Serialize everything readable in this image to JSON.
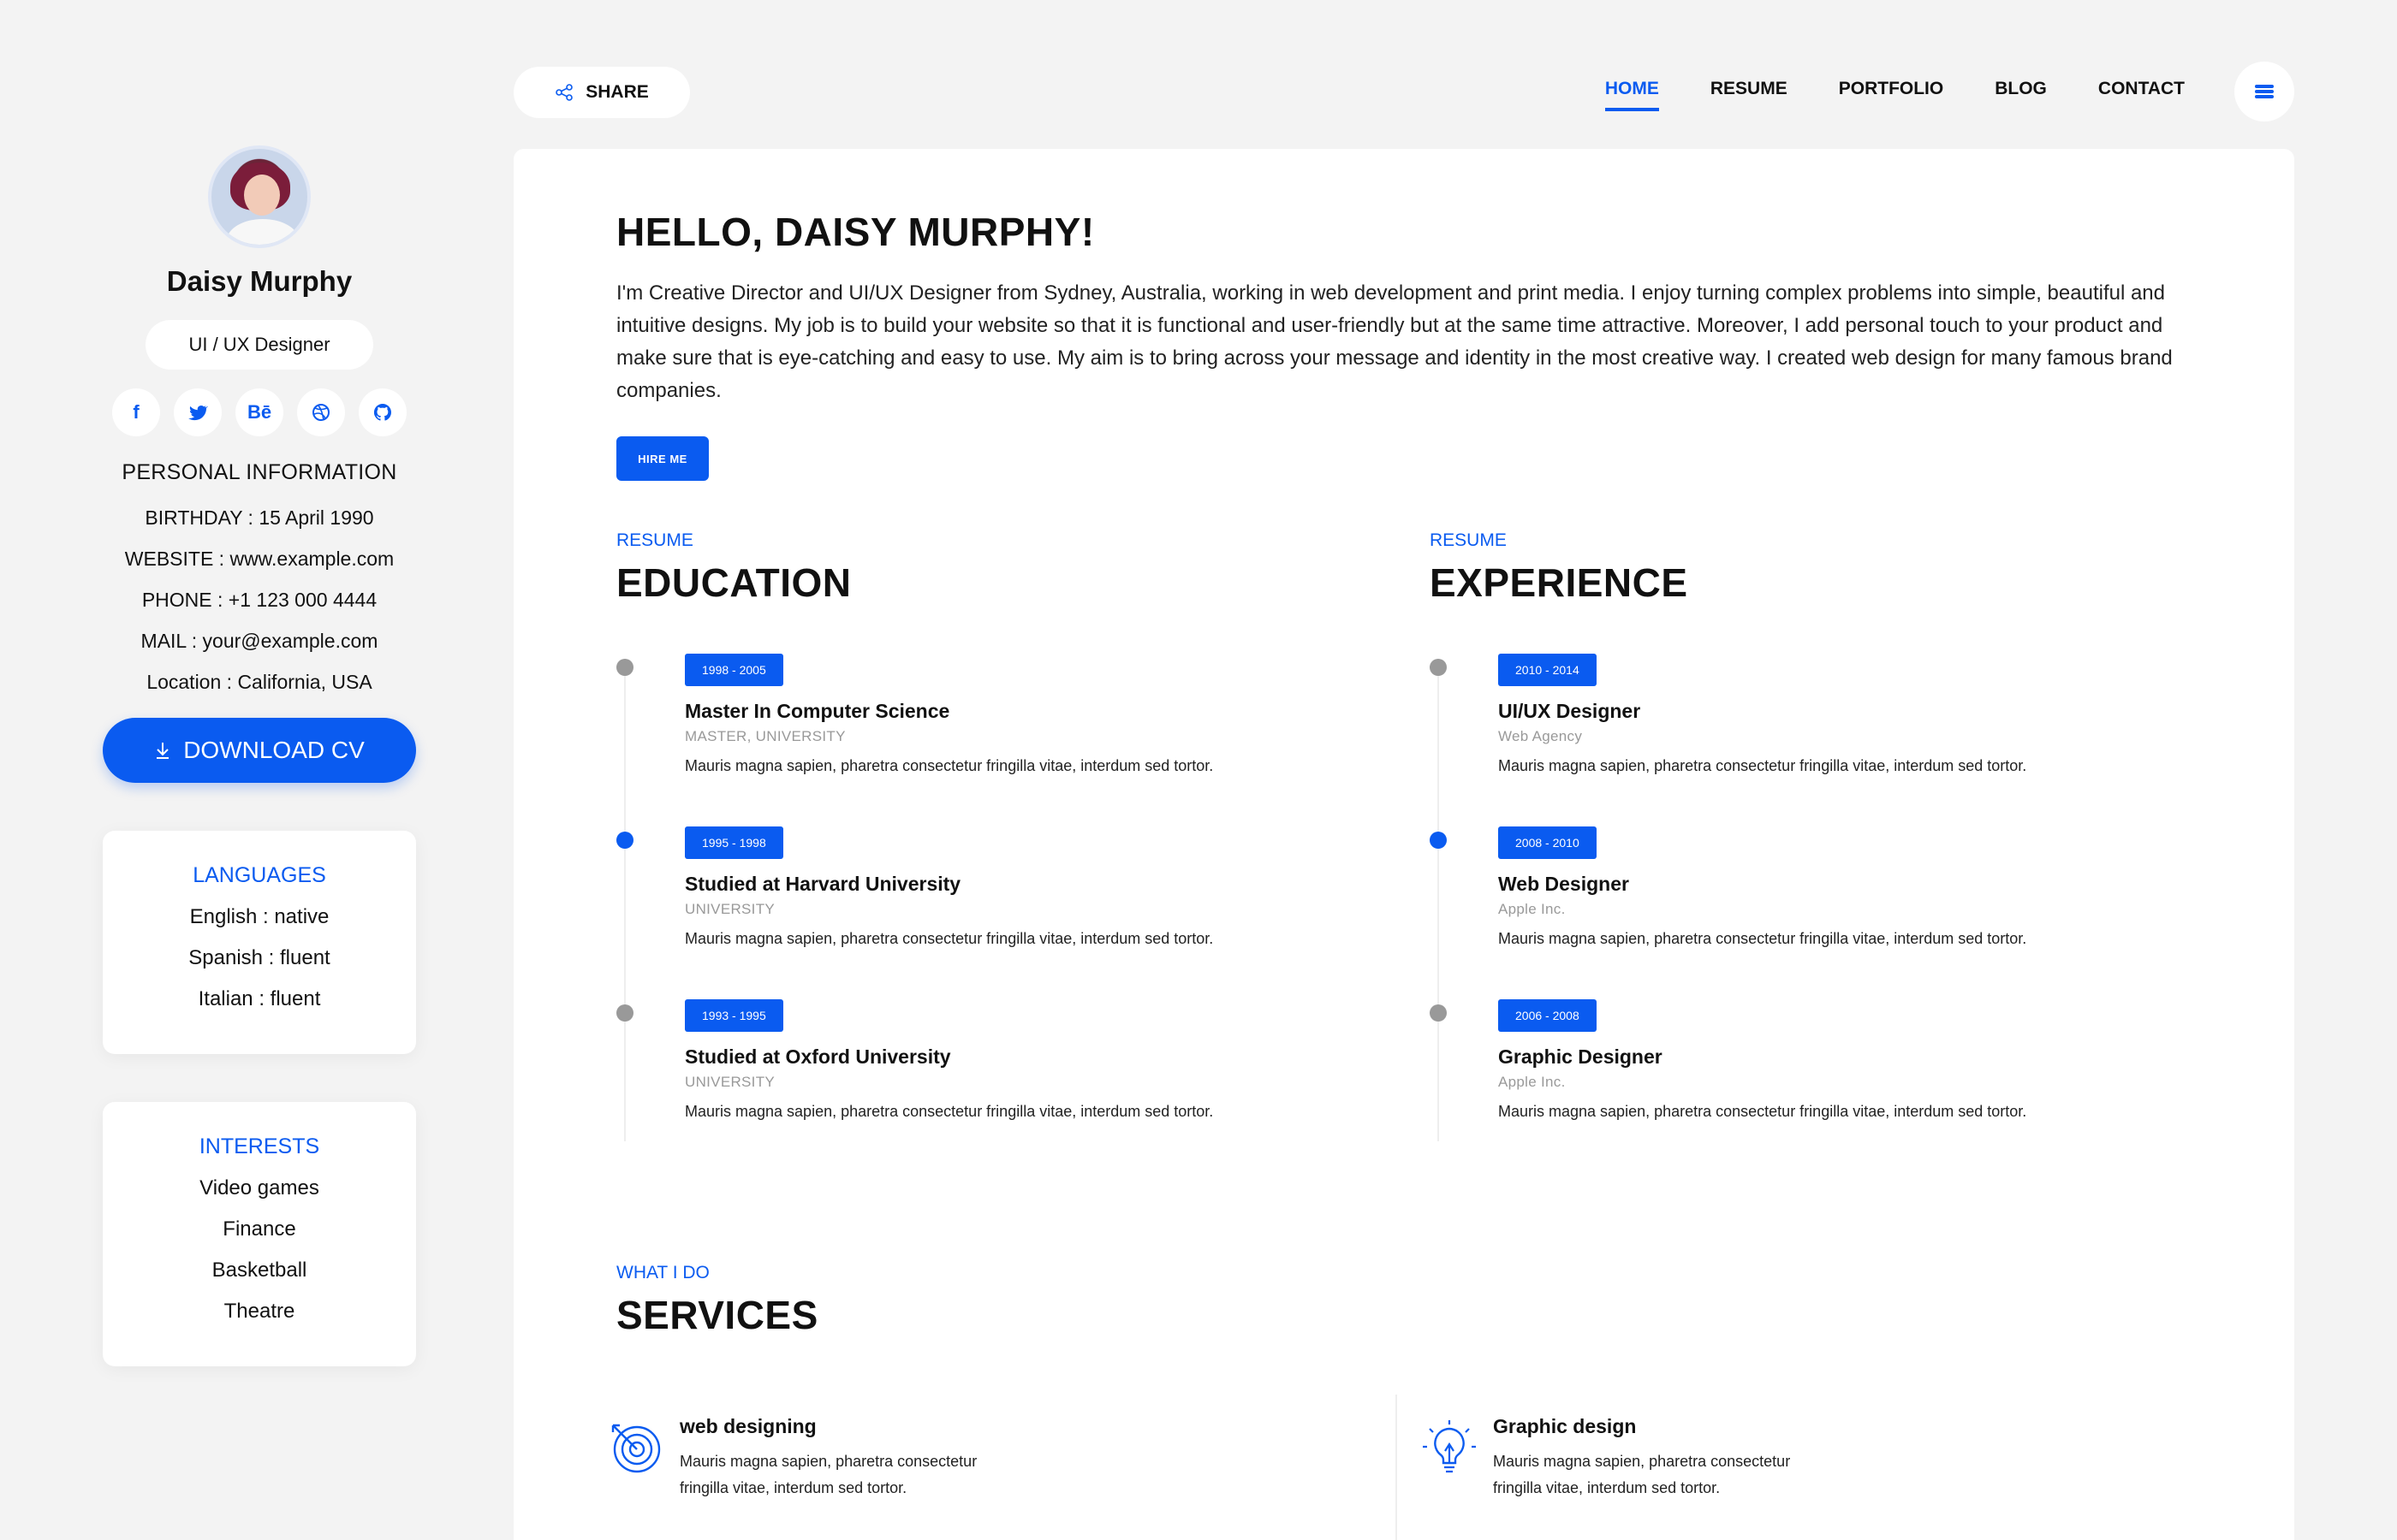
{
  "profile": {
    "name": "Daisy Murphy",
    "role": "UI / UX Designer",
    "socials": [
      {
        "icon": "facebook-icon",
        "glyph": "f"
      },
      {
        "icon": "twitter-icon",
        "glyph": "t"
      },
      {
        "icon": "behance-icon",
        "glyph": "Bē"
      },
      {
        "icon": "dribbble-icon",
        "glyph": "◎"
      },
      {
        "icon": "github-icon",
        "glyph": "⌾"
      }
    ],
    "personal_info_title": "PERSONAL INFORMATION",
    "personal_info": [
      "BIRTHDAY : 15 April 1990",
      "WEBSITE : www.example.com",
      "PHONE : +1 123 000 4444",
      "MAIL : your@example.com",
      "Location : California, USA"
    ],
    "download_label": "DOWNLOAD CV"
  },
  "languages": {
    "title": "LANGUAGES",
    "items": [
      "English : native",
      "Spanish : fluent",
      "Italian : fluent"
    ]
  },
  "interests": {
    "title": "INTERESTS",
    "items": [
      "Video games",
      "Finance",
      "Basketball",
      "Theatre"
    ]
  },
  "topbar": {
    "share_label": "SHARE",
    "nav": [
      "HOME",
      "RESUME",
      "PORTFOLIO",
      "BLOG",
      "CONTACT"
    ],
    "active_nav": "HOME"
  },
  "main": {
    "greeting": "HELLO, DAISY MURPHY!",
    "intro": "I'm Creative Director and UI/UX Designer from Sydney, Australia, working in web development and print media. I enjoy turning complex problems into simple, beautiful and intuitive designs. My job is to build your website so that it is functional and user-friendly but at the same time attractive. Moreover, I add personal touch to your product and make sure that is eye-catching and easy to use. My aim is to bring across your message and identity in the most creative way. I created web design for many famous brand companies.",
    "hire_label": "HIRE ME",
    "education": {
      "kicker": "RESUME",
      "title": "EDUCATION",
      "items": [
        {
          "date": "1998 - 2005",
          "title": "Master In Computer Science",
          "sub": "MASTER, UNIVERSITY",
          "desc": "Mauris magna sapien, pharetra consectetur fringilla vitae, interdum sed tortor.",
          "active": false
        },
        {
          "date": "1995 - 1998",
          "title": "Studied at Harvard University",
          "sub": "UNIVERSITY",
          "desc": "Mauris magna sapien, pharetra consectetur fringilla vitae, interdum sed tortor.",
          "active": true
        },
        {
          "date": "1993 - 1995",
          "title": "Studied at Oxford University",
          "sub": "UNIVERSITY",
          "desc": "Mauris magna sapien, pharetra consectetur fringilla vitae, interdum sed tortor.",
          "active": false
        }
      ]
    },
    "experience": {
      "kicker": "RESUME",
      "title": "EXPERIENCE",
      "items": [
        {
          "date": "2010 - 2014",
          "title": "UI/UX Designer",
          "sub": "Web Agency",
          "desc": "Mauris magna sapien, pharetra consectetur fringilla vitae, interdum sed tortor.",
          "active": false
        },
        {
          "date": "2008 - 2010",
          "title": "Web Designer",
          "sub": "Apple Inc.",
          "desc": "Mauris magna sapien, pharetra consectetur fringilla vitae, interdum sed tortor.",
          "active": true
        },
        {
          "date": "2006 - 2008",
          "title": "Graphic Designer",
          "sub": "Apple Inc.",
          "desc": "Mauris magna sapien, pharetra consectetur fringilla vitae, interdum sed tortor.",
          "active": false
        }
      ]
    },
    "services": {
      "kicker": "WHAT I DO",
      "title": "SERVICES",
      "items": [
        {
          "icon": "target-icon",
          "title": "web designing",
          "desc": "Mauris magna sapien, pharetra consectetur fringilla vitae, interdum sed tortor."
        },
        {
          "icon": "lightbulb-icon",
          "title": "Graphic design",
          "desc": "Mauris magna sapien, pharetra consectetur fringilla vitae, interdum sed tortor."
        }
      ]
    }
  },
  "colors": {
    "accent": "#0a5bf0",
    "background": "#f3f3f3",
    "muted_dot": "#999999"
  }
}
